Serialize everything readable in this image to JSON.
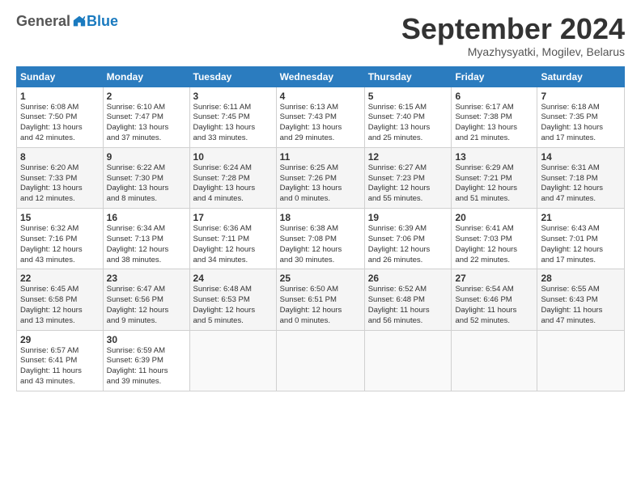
{
  "logo": {
    "general": "General",
    "blue": "Blue"
  },
  "title": "September 2024",
  "location": "Myazhysyatki, Mogilev, Belarus",
  "headers": [
    "Sunday",
    "Monday",
    "Tuesday",
    "Wednesday",
    "Thursday",
    "Friday",
    "Saturday"
  ],
  "weeks": [
    [
      {
        "day": "1",
        "info": "Sunrise: 6:08 AM\nSunset: 7:50 PM\nDaylight: 13 hours\nand 42 minutes."
      },
      {
        "day": "2",
        "info": "Sunrise: 6:10 AM\nSunset: 7:47 PM\nDaylight: 13 hours\nand 37 minutes."
      },
      {
        "day": "3",
        "info": "Sunrise: 6:11 AM\nSunset: 7:45 PM\nDaylight: 13 hours\nand 33 minutes."
      },
      {
        "day": "4",
        "info": "Sunrise: 6:13 AM\nSunset: 7:43 PM\nDaylight: 13 hours\nand 29 minutes."
      },
      {
        "day": "5",
        "info": "Sunrise: 6:15 AM\nSunset: 7:40 PM\nDaylight: 13 hours\nand 25 minutes."
      },
      {
        "day": "6",
        "info": "Sunrise: 6:17 AM\nSunset: 7:38 PM\nDaylight: 13 hours\nand 21 minutes."
      },
      {
        "day": "7",
        "info": "Sunrise: 6:18 AM\nSunset: 7:35 PM\nDaylight: 13 hours\nand 17 minutes."
      }
    ],
    [
      {
        "day": "8",
        "info": "Sunrise: 6:20 AM\nSunset: 7:33 PM\nDaylight: 13 hours\nand 12 minutes."
      },
      {
        "day": "9",
        "info": "Sunrise: 6:22 AM\nSunset: 7:30 PM\nDaylight: 13 hours\nand 8 minutes."
      },
      {
        "day": "10",
        "info": "Sunrise: 6:24 AM\nSunset: 7:28 PM\nDaylight: 13 hours\nand 4 minutes."
      },
      {
        "day": "11",
        "info": "Sunrise: 6:25 AM\nSunset: 7:26 PM\nDaylight: 13 hours\nand 0 minutes."
      },
      {
        "day": "12",
        "info": "Sunrise: 6:27 AM\nSunset: 7:23 PM\nDaylight: 12 hours\nand 55 minutes."
      },
      {
        "day": "13",
        "info": "Sunrise: 6:29 AM\nSunset: 7:21 PM\nDaylight: 12 hours\nand 51 minutes."
      },
      {
        "day": "14",
        "info": "Sunrise: 6:31 AM\nSunset: 7:18 PM\nDaylight: 12 hours\nand 47 minutes."
      }
    ],
    [
      {
        "day": "15",
        "info": "Sunrise: 6:32 AM\nSunset: 7:16 PM\nDaylight: 12 hours\nand 43 minutes."
      },
      {
        "day": "16",
        "info": "Sunrise: 6:34 AM\nSunset: 7:13 PM\nDaylight: 12 hours\nand 38 minutes."
      },
      {
        "day": "17",
        "info": "Sunrise: 6:36 AM\nSunset: 7:11 PM\nDaylight: 12 hours\nand 34 minutes."
      },
      {
        "day": "18",
        "info": "Sunrise: 6:38 AM\nSunset: 7:08 PM\nDaylight: 12 hours\nand 30 minutes."
      },
      {
        "day": "19",
        "info": "Sunrise: 6:39 AM\nSunset: 7:06 PM\nDaylight: 12 hours\nand 26 minutes."
      },
      {
        "day": "20",
        "info": "Sunrise: 6:41 AM\nSunset: 7:03 PM\nDaylight: 12 hours\nand 22 minutes."
      },
      {
        "day": "21",
        "info": "Sunrise: 6:43 AM\nSunset: 7:01 PM\nDaylight: 12 hours\nand 17 minutes."
      }
    ],
    [
      {
        "day": "22",
        "info": "Sunrise: 6:45 AM\nSunset: 6:58 PM\nDaylight: 12 hours\nand 13 minutes."
      },
      {
        "day": "23",
        "info": "Sunrise: 6:47 AM\nSunset: 6:56 PM\nDaylight: 12 hours\nand 9 minutes."
      },
      {
        "day": "24",
        "info": "Sunrise: 6:48 AM\nSunset: 6:53 PM\nDaylight: 12 hours\nand 5 minutes."
      },
      {
        "day": "25",
        "info": "Sunrise: 6:50 AM\nSunset: 6:51 PM\nDaylight: 12 hours\nand 0 minutes."
      },
      {
        "day": "26",
        "info": "Sunrise: 6:52 AM\nSunset: 6:48 PM\nDaylight: 11 hours\nand 56 minutes."
      },
      {
        "day": "27",
        "info": "Sunrise: 6:54 AM\nSunset: 6:46 PM\nDaylight: 11 hours\nand 52 minutes."
      },
      {
        "day": "28",
        "info": "Sunrise: 6:55 AM\nSunset: 6:43 PM\nDaylight: 11 hours\nand 47 minutes."
      }
    ],
    [
      {
        "day": "29",
        "info": "Sunrise: 6:57 AM\nSunset: 6:41 PM\nDaylight: 11 hours\nand 43 minutes."
      },
      {
        "day": "30",
        "info": "Sunrise: 6:59 AM\nSunset: 6:39 PM\nDaylight: 11 hours\nand 39 minutes."
      },
      {
        "day": "",
        "info": ""
      },
      {
        "day": "",
        "info": ""
      },
      {
        "day": "",
        "info": ""
      },
      {
        "day": "",
        "info": ""
      },
      {
        "day": "",
        "info": ""
      }
    ]
  ]
}
